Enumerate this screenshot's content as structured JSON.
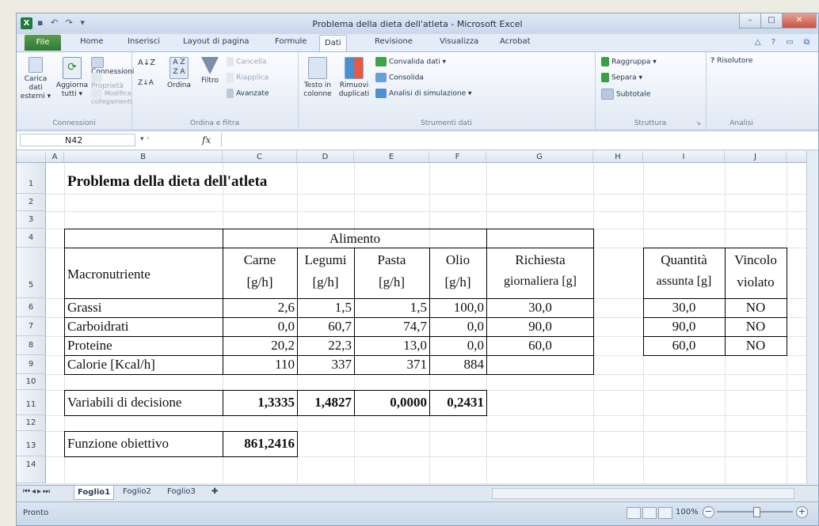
{
  "window": {
    "title": "Problema della dieta dell'atleta - Microsoft Excel",
    "app_logo": "X"
  },
  "ribbon_tabs": [
    "File",
    "Home",
    "Inserisci",
    "Layout di pagina",
    "Formule",
    "Dati",
    "Revisione",
    "Visualizza",
    "Acrobat"
  ],
  "active_tab": "Dati",
  "ribbon": {
    "external": {
      "label1": "Carica dati",
      "label2": "esterni ▾"
    },
    "refresh": {
      "label1": "Aggiorna",
      "label2": "tutti ▾"
    },
    "connections": {
      "connessioni": "Connessioni",
      "proprieta": "Proprietà",
      "modifica": "Modifica collegamenti",
      "group": "Connessioni"
    },
    "sort": {
      "az": "A↓Z",
      "sort_btn": "Ordina",
      "filter": "Filtro",
      "cancella": "Cancella",
      "riapplica": "Riapplica",
      "avanzate": "Avanzate",
      "group": "Ordina e filtra"
    },
    "tools": {
      "testo": "Testo in",
      "colonne": "colonne",
      "rimuovi": "Rimuovi",
      "duplicati": "duplicati",
      "convalida": "Convalida dati ▾",
      "consolida": "Consolida",
      "analisi": "Analisi di simulazione ▾",
      "group": "Strumenti dati"
    },
    "outline": {
      "raggruppa": "Raggruppa ▾",
      "separa": "Separa ▾",
      "subtotale": "Subtotale",
      "group": "Struttura"
    },
    "analysis": {
      "risolutore": "Risolutore",
      "group": "Analisi"
    }
  },
  "formula_bar": {
    "name_box": "N42",
    "fx": "fx",
    "formula": ""
  },
  "columns": [
    "A",
    "B",
    "C",
    "D",
    "E",
    "F",
    "G",
    "H",
    "I",
    "J"
  ],
  "rows": [
    "1",
    "2",
    "3",
    "4",
    "5",
    "6",
    "7",
    "8",
    "9",
    "10",
    "11",
    "12",
    "13",
    "14"
  ],
  "sheet": {
    "title": "Problema della dieta dell'atleta",
    "alimento": "Alimento",
    "macronutriente": "Macronutriente",
    "foods": [
      {
        "name": "Carne",
        "unit": "[g/h]"
      },
      {
        "name": "Legumi",
        "unit": "[g/h]"
      },
      {
        "name": "Pasta",
        "unit": "[g/h]"
      },
      {
        "name": "Olio",
        "unit": "[g/h]"
      }
    ],
    "richiesta": {
      "line1": "Richiesta",
      "line2": "giornaliera [g]"
    },
    "quantita": {
      "line1": "Quantità",
      "line2": "assunta [g]"
    },
    "vincolo": {
      "line1": "Vincolo",
      "line2": "violato"
    },
    "nutrients": [
      {
        "name": "Grassi",
        "values": [
          "2,6",
          "1,5",
          "1,5",
          "100,0"
        ],
        "req": "30,0",
        "qty": "30,0",
        "viol": "NO"
      },
      {
        "name": "Carboidrati",
        "values": [
          "0,0",
          "60,7",
          "74,7",
          "0,0"
        ],
        "req": "90,0",
        "qty": "90,0",
        "viol": "NO"
      },
      {
        "name": "Proteine",
        "values": [
          "20,2",
          "22,3",
          "13,0",
          "0,0"
        ],
        "req": "60,0",
        "qty": "60,0",
        "viol": "NO"
      }
    ],
    "calorie": {
      "name": "Calorie [Kcal/h]",
      "values": [
        "110",
        "337",
        "371",
        "884"
      ]
    },
    "decision": {
      "name": "Variabili di decisione",
      "values": [
        "1,3335",
        "1,4827",
        "0,0000",
        "0,2431"
      ]
    },
    "objective": {
      "name": "Funzione obiettivo",
      "value": "861,2416"
    }
  },
  "sheet_tabs": [
    "Foglio1",
    "Foglio2",
    "Foglio3"
  ],
  "status": {
    "ready": "Pronto",
    "zoom": "100%"
  },
  "colors": {
    "excel_green": "#1e7a3c",
    "ribbon_blue": "#e4ecf7"
  }
}
